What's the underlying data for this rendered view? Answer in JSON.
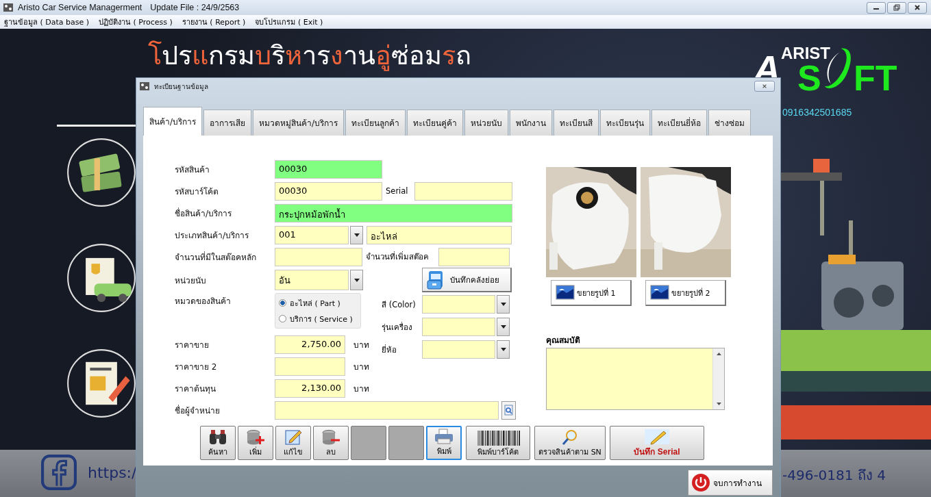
{
  "window": {
    "title": "Aristo Car Service Managerment",
    "update": "Update File : 24/9/2563"
  },
  "menu": [
    "ฐานข้อมูล ( Data base )",
    "ปฏิบัติงาน ( Process )",
    "รายงาน ( Report )",
    "จบโปรแกรม ( Exit )"
  ],
  "background": {
    "heading": [
      {
        "text": "โ",
        "accent": true
      },
      {
        "text": "ปร",
        "accent": false
      },
      {
        "text": "แ",
        "accent": true
      },
      {
        "text": "กรม",
        "accent": false
      },
      {
        "text": "บ",
        "accent": true
      },
      {
        "text": "ริ",
        "accent": false
      },
      {
        "text": "ห",
        "accent": true
      },
      {
        "text": "าร",
        "accent": false
      },
      {
        "text": "ง",
        "accent": true
      },
      {
        "text": "าน",
        "accent": false
      },
      {
        "text": "อู่",
        "accent": true
      },
      {
        "text": "ซ่อม",
        "accent": false
      },
      {
        "text": "ร",
        "accent": true
      },
      {
        "text": "ถ",
        "accent": false
      }
    ],
    "logo": {
      "top": "ARIST",
      "first": "A",
      "bottom_left": "S",
      "bottom_right": "FT"
    },
    "phone": "0916342501685",
    "link": "https:/",
    "banner_text": "-496-0181 ถึง 4"
  },
  "dialog": {
    "title": "ทะเบียนฐานข้อมูล",
    "tabs": [
      {
        "label": "สินค้า/บริการ",
        "selected": true
      },
      {
        "label": "อาการเสีย",
        "selected": false
      },
      {
        "label": "หมวดหมู่สินค้า/บริการ",
        "selected": false
      },
      {
        "label": "ทะเบียนลูกค้า",
        "selected": false
      },
      {
        "label": "ทะเบียนคู่ค้า",
        "selected": false
      },
      {
        "label": "หน่วยนับ",
        "selected": false
      },
      {
        "label": "พนักงาน",
        "selected": false
      },
      {
        "label": "ทะเบียนสี",
        "selected": false
      },
      {
        "label": "ทะเบียนรุ่น",
        "selected": false
      },
      {
        "label": "ทะเบียนยี่ห้อ",
        "selected": false
      },
      {
        "label": "ช่างซ่อม",
        "selected": false
      }
    ],
    "form": {
      "product_code": {
        "label": "รหัสสินค้า",
        "value": "00030",
        "highlighted": true
      },
      "barcode": {
        "label": "รหัสบาร์โค้ต",
        "value": "00030",
        "highlighted": false
      },
      "serial": {
        "label": "Serial"
      },
      "name": {
        "label": "ชื่อสินค้า/บริการ",
        "value": "กระปุกหม้อพักน้ำ",
        "highlighted": true
      },
      "type": {
        "label": "ประเภทสินค้า/บริการ",
        "code": "001",
        "name": "อะไหล่"
      },
      "stock_main": {
        "label": "จำนวนที่มีในสต๊อคหลัก"
      },
      "stock_add": {
        "label": "จำนวนที่เพิ่มสต๊อค"
      },
      "unit": {
        "label": "หน่วยนับ",
        "value": "อัน"
      },
      "sub_stock_button": "บันทึกคลังย่อย",
      "category": {
        "label": "หมวดของสินค้า",
        "options": [
          {
            "label": "อะไหล่ ( Part )",
            "selected": true
          },
          {
            "label": "บริการ ( Service )",
            "selected": false
          }
        ]
      },
      "color": {
        "label": "สี (Color)"
      },
      "model": {
        "label": "รุ่นเครื่อง"
      },
      "brand": {
        "label": "ยี่ห้อ"
      },
      "prices": [
        {
          "label": "ราคาขาย",
          "value": "2,750.00",
          "unit": "บาท"
        },
        {
          "label": "ราคาขาย 2",
          "unit": "บาท"
        },
        {
          "label": "ราคาต้นทุน",
          "value": "2,130.00",
          "unit": "บาท"
        }
      ],
      "supplier": {
        "label": "ชื่อผู้จำหน่าย"
      }
    },
    "images": [
      {
        "kind": "picture",
        "button": "ขยายรูปที่ 1"
      },
      {
        "kind": "picture",
        "button": "ขยายรูปที่ 2"
      }
    ],
    "properties": {
      "label": "คุณสมบัติ"
    },
    "toolbar": [
      {
        "kind": "search",
        "label": "ค้นหา",
        "focused": false
      },
      {
        "kind": "add",
        "label": "เพิ่ม",
        "focused": false
      },
      {
        "kind": "edit",
        "label": "แก้ไข",
        "focused": false
      },
      {
        "kind": "delete",
        "label": "ลบ",
        "focused": false
      },
      {
        "kind": "blank",
        "focused": false
      },
      {
        "kind": "blank",
        "focused": false
      },
      {
        "kind": "print",
        "label": "พิมพ์",
        "focused": true
      },
      {
        "kind": "barcode",
        "label": "พิมพ์บาร์โค้ต",
        "focused": false
      },
      {
        "kind": "check",
        "label": "ตรวจสินค้าตาม SN",
        "focused": false
      },
      {
        "kind": "save",
        "label": "บันทึก Serial",
        "focused": false
      }
    ],
    "exit_button": "จบการทำงาน"
  }
}
